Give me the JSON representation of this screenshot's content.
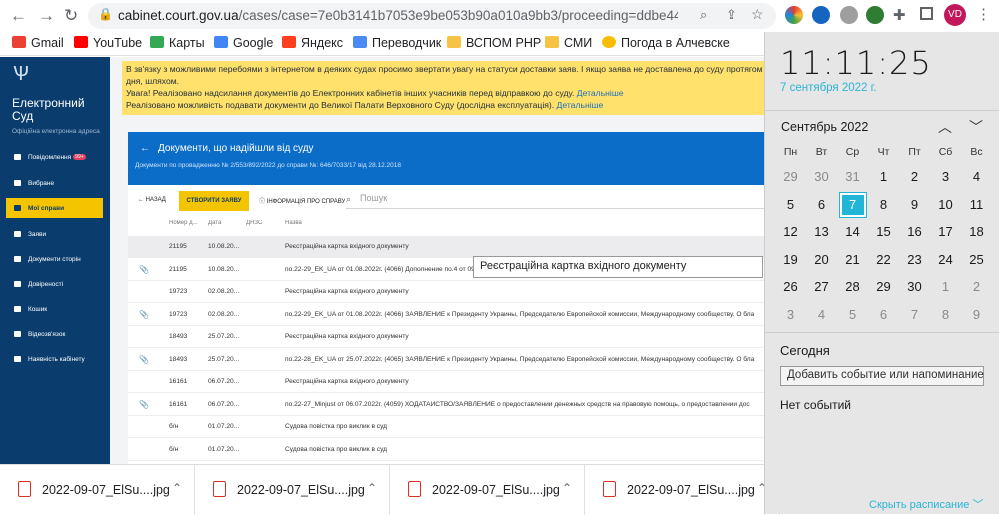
{
  "browser": {
    "url_domain": "cabinet.court.gov.ua",
    "url_rest": "/cases/case=7e0b3141b7053e9be053b90a010a9bb3/proceeding=ddbe4422bc68b87be...",
    "avatar": "VD"
  },
  "bookmarks": [
    "Gmail",
    "YouTube",
    "Карты",
    "Google",
    "Яндекс",
    "Переводчик",
    "ВСПОМ РНР",
    "СМИ",
    "Погода в Алчевске"
  ],
  "sidebar": {
    "title": "Електронний Суд",
    "subtitle": "Офіційна електронна адреса",
    "items": [
      {
        "label": "Повідомлення",
        "badge": "99+"
      },
      {
        "label": "Вибране"
      },
      {
        "label": "Мої справи"
      },
      {
        "label": "Заяви"
      },
      {
        "label": "Документи сторін"
      },
      {
        "label": "Довіреності"
      },
      {
        "label": "Кошик"
      },
      {
        "label": "Відеозв'язок"
      },
      {
        "label": "Наявність кабінету"
      }
    ]
  },
  "notice": {
    "line1": "В зв'язку з можливими перебоями з інтернетом в деяких судах просимо звертати увагу на статуси доставки заяв. І якщо заява не доставлена до суду протягом дня, шляхом.",
    "line2": "Увага! Реалізовано надсилання документів до Електронних кабінетів інших учасників перед відправкою до суду.",
    "line3": "Реалізовано можливість подавати документи до Великої Палати Верховного Суду (дослідна експлуатація).",
    "link": "Детальніше"
  },
  "card": {
    "title": "Документи, що надійшли від суду",
    "subtitle": "Документи по провадженню № 2/553/892/2022 до справи №: 646/7033/17 від 28.12.2018",
    "back": "НАЗАД",
    "create": "СТВОРИТИ ЗАЯВУ",
    "info": "ІНФОРМАЦІЯ ПРО СПРАВУ",
    "search_placeholder": "Пошук",
    "columns": [
      "Номер д...",
      "Дата",
      "ДНЗС",
      "Назва"
    ],
    "rows": [
      {
        "num": "21195",
        "date": "10.08.20...",
        "name": "Реєстраційна картка вхідного документу",
        "clip": false
      },
      {
        "num": "21195",
        "date": "10.08.20...",
        "name": "по.22-29_EK_UA от 01.08.2022г. (4066) Дополнение по.4 от 09.08.2022г., (4066 абз.7) ЗАЯВЛЕНИЕ",
        "clip": true
      },
      {
        "num": "19723",
        "date": "02.08.20...",
        "name": "Реєстраційна картка вхідного документу",
        "clip": false
      },
      {
        "num": "19723",
        "date": "02.08.20...",
        "name": "по.22-29_EK_UA от 01.08.2022г. (4066) ЗАЯВЛЕНИЕ к Президенту Украины, Председателю Европейской комиссии, Международному сообществу. О бла",
        "clip": true
      },
      {
        "num": "18493",
        "date": "25.07.20...",
        "name": "Реєстраційна картка вхідного документу",
        "clip": false
      },
      {
        "num": "18493",
        "date": "25.07.20...",
        "name": "по.22-28_EK_UA от 25.07.2022г. (4065) ЗАЯВЛЕНИЕ к Президенту Украины, Председателю Европейской комиссии, Международному сообществу. О бла",
        "clip": true
      },
      {
        "num": "16161",
        "date": "06.07.20...",
        "name": "Реєстраційна картка вхідного документу",
        "clip": false
      },
      {
        "num": "16161",
        "date": "06.07.20...",
        "name": "по.22-27_Minjust от 06.07.2022г. (4059) ХОДАТАЙСТВО/ЗАЯВЛЕНИЕ о предоставлении денежных средств на правовую помощь, о предоставлении дос",
        "clip": true
      },
      {
        "num": "б/н",
        "date": "01.07.20...",
        "name": "Судова повістка про виклик в суд",
        "clip": false
      },
      {
        "num": "б/н",
        "date": "01.07.20...",
        "name": "Судова повістка про виклик в суд",
        "clip": false
      }
    ],
    "tooltip": "Реєстраційна картка вхідного документу"
  },
  "downloads": [
    "2022-09-07_ElSu....jpg",
    "2022-09-07_ElSu....jpg",
    "2022-09-07_ElSu....jpg",
    "2022-09-07_ElSu....jpg"
  ],
  "calendar": {
    "time": "11:11:25",
    "date": "7 сентября 2022 г.",
    "month": "Сентябрь 2022",
    "dow": [
      "Пн",
      "Вт",
      "Ср",
      "Чт",
      "Пт",
      "Сб",
      "Вс"
    ],
    "weeks": [
      [
        "29",
        "30",
        "31",
        "1",
        "2",
        "3",
        "4"
      ],
      [
        "5",
        "6",
        "7",
        "8",
        "9",
        "10",
        "11"
      ],
      [
        "12",
        "13",
        "14",
        "15",
        "16",
        "17",
        "18"
      ],
      [
        "19",
        "20",
        "21",
        "22",
        "23",
        "24",
        "25"
      ],
      [
        "26",
        "27",
        "28",
        "29",
        "30",
        "1",
        "2"
      ],
      [
        "3",
        "4",
        "5",
        "6",
        "7",
        "8",
        "9"
      ]
    ],
    "today": "7",
    "today_label": "Сегодня",
    "add_event": "Добавить событие или напоминание",
    "no_events": "Нет событий",
    "hide_schedule": "Скрыть расписание"
  }
}
